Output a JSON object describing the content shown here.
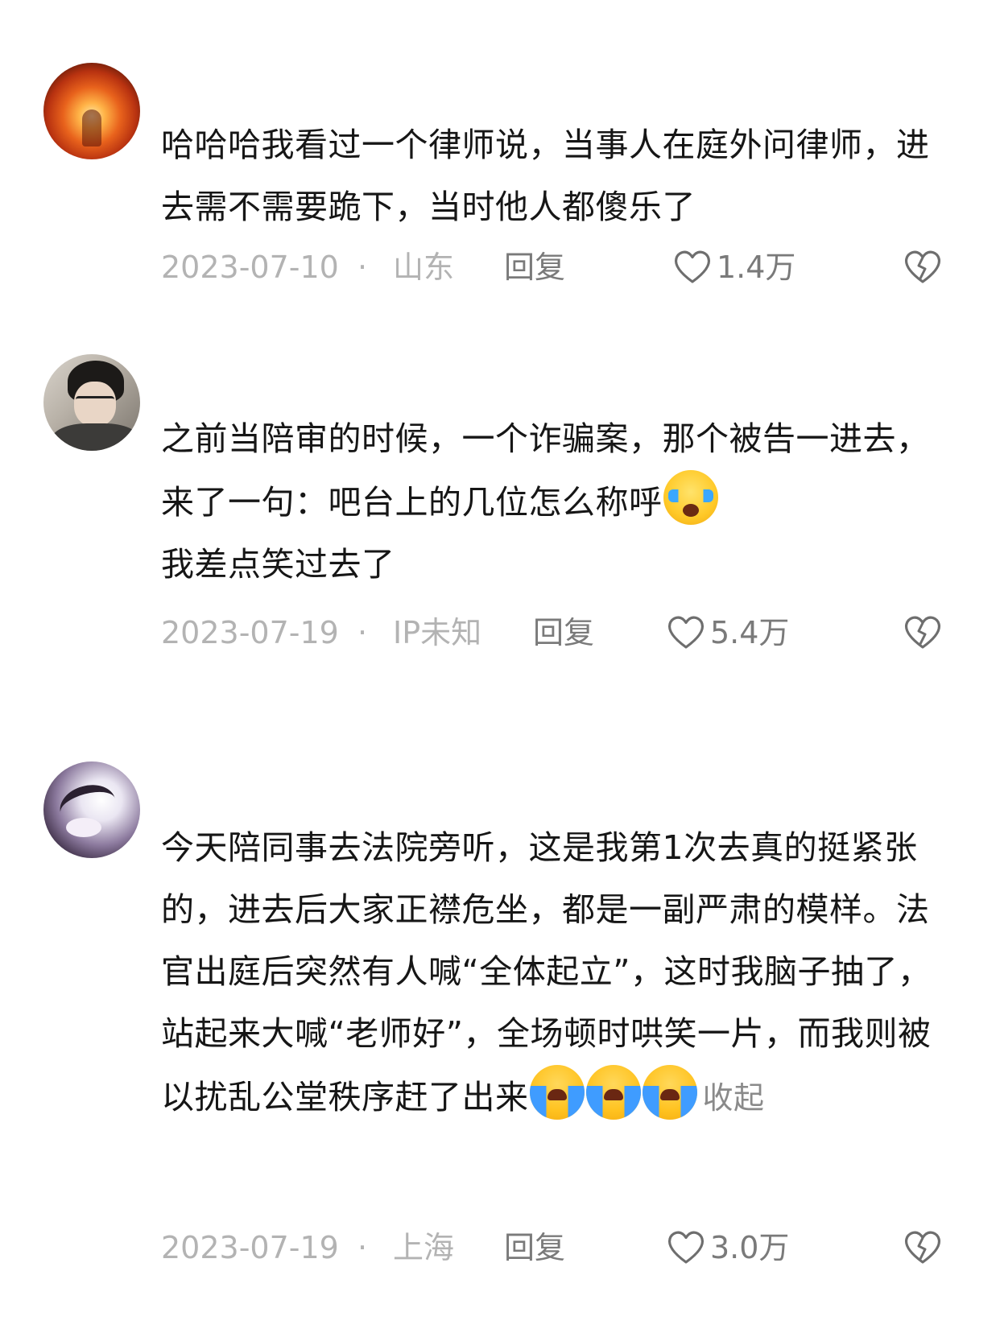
{
  "comments": [
    {
      "text": "哈哈哈我看过一个律师说，当事人在庭外问律师，进去需不需要跪下，当时他人都傻乐了",
      "date": "2023-07-10",
      "separator": "·",
      "location": "山东",
      "reply_label": "回复",
      "likes": "1.4万",
      "avatar_icon": "flame-figure-avatar"
    },
    {
      "text_before_emoji": "之前当陪审的时候，一个诈骗案，那个被告一进去，来了一句：吧台上的几位怎么称呼",
      "text_after_emoji": "我差点笑过去了",
      "emoji_icon": "tears-of-joy-emoji",
      "date": "2023-07-19",
      "separator": "·",
      "location": "IP未知",
      "reply_label": "回复",
      "likes": "5.4万",
      "avatar_icon": "man-with-glasses-avatar"
    },
    {
      "text": "今天陪同事去法院旁听，这是我第1次去真的挺紧张的，进去后大家正襟危坐，都是一副严肃的模样。法官出庭后突然有人喊“全体起立”，这时我脑子抽了，站起来大喊“老师好”，全场顿时哄笑一片，而我则被以扰乱公堂秩序赶了出来",
      "emoji_icon": "loudly-crying-emoji",
      "emoji_count": 3,
      "collapse_label": "收起",
      "date": "2023-07-19",
      "separator": "·",
      "location": "上海",
      "reply_label": "回复",
      "likes": "3.0万",
      "avatar_icon": "anime-character-avatar"
    }
  ],
  "colors": {
    "text": "#161616",
    "meta": "#b3b3b3",
    "action": "#7a7a7a"
  }
}
